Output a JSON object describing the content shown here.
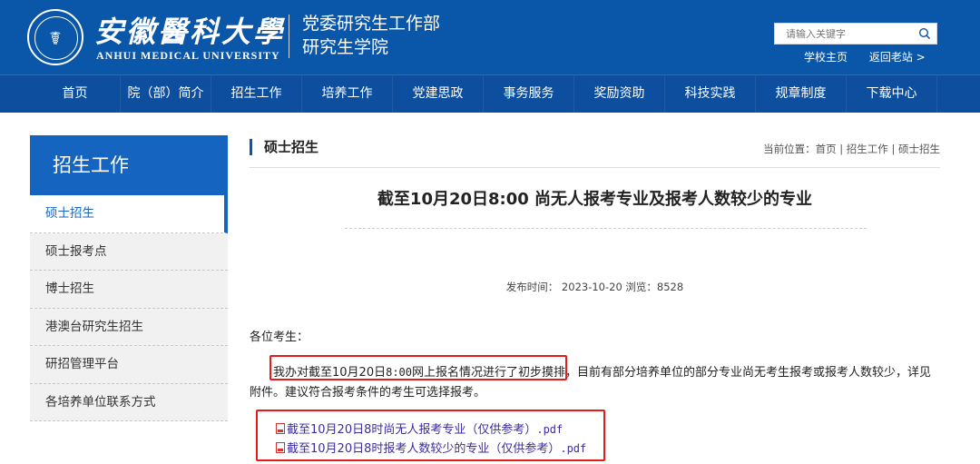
{
  "header": {
    "university_cn": "安徽醫科大學",
    "university_en": "ANHUI MEDICAL UNIVERSITY",
    "dept_line1": "党委研究生工作部",
    "dept_line2": "研究生学院",
    "emblem_glyph": "☤",
    "search_placeholder": "请输入关键字",
    "links": [
      "学校主页",
      "返回老站 >"
    ]
  },
  "nav": {
    "items": [
      "首页",
      "院（部）简介",
      "招生工作",
      "培养工作",
      "党建思政",
      "事务服务",
      "奖励资助",
      "科技实践",
      "规章制度",
      "下载中心"
    ]
  },
  "sidebar": {
    "title": "招生工作",
    "items": [
      "硕士招生",
      "硕士报考点",
      "博士招生",
      "港澳台研究生招生",
      "研招管理平台",
      "各培养单位联系方式"
    ],
    "active_index": 0
  },
  "content": {
    "section_title": "硕士招生",
    "breadcrumb": "当前位置：首页 | 招生工作 | 硕士招生",
    "article_title": "截至10月20日8:00 尚无人报考专业及报考人数较少的专业",
    "meta": "发布时间：  2023-10-20 浏览：8528",
    "greeting": "各位考生：",
    "para_a": "我办对截至10月20日",
    "para_b": "8:00",
    "para_c": "网上报名情况进行了初步摸排，目前有部分培养单位的部分专业尚无考生报考或报考人数较少，详见附件。建议符合报考条件的考生可选择报考。",
    "files": [
      {
        "name": "截至10月20日8时尚无人报考专业（仅供参考）",
        "ext": ".pdf"
      },
      {
        "name": "截至10月20日8时报考人数较少的专业（仅供参考）",
        "ext": ".pdf"
      }
    ]
  },
  "colors": {
    "brand_blue": "#0a56a8",
    "highlight_red": "#e21b1b",
    "link_purple": "#3a2ca3"
  }
}
